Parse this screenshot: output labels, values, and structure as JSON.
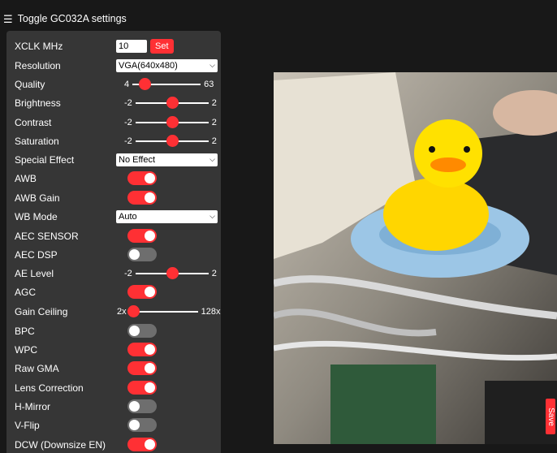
{
  "header": {
    "title": "Toggle GC032A settings"
  },
  "xclk": {
    "label": "XCLK MHz",
    "value": "10",
    "set_label": "Set"
  },
  "resolution": {
    "label": "Resolution",
    "selected": "VGA(640x480)"
  },
  "quality": {
    "label": "Quality",
    "min": "4",
    "max": "63",
    "value": 0.18
  },
  "brightness": {
    "label": "Brightness",
    "min": "-2",
    "max": "2",
    "value": 0.5
  },
  "contrast": {
    "label": "Contrast",
    "min": "-2",
    "max": "2",
    "value": 0.5
  },
  "saturation": {
    "label": "Saturation",
    "min": "-2",
    "max": "2",
    "value": 0.5
  },
  "special_effect": {
    "label": "Special Effect",
    "selected": "No Effect"
  },
  "awb": {
    "label": "AWB",
    "on": true
  },
  "awb_gain": {
    "label": "AWB Gain",
    "on": true
  },
  "wb_mode": {
    "label": "WB Mode",
    "selected": "Auto"
  },
  "aec_sensor": {
    "label": "AEC SENSOR",
    "on": true
  },
  "aec_dsp": {
    "label": "AEC DSP",
    "on": false
  },
  "ae_level": {
    "label": "AE Level",
    "min": "-2",
    "max": "2",
    "value": 0.5
  },
  "agc": {
    "label": "AGC",
    "on": true
  },
  "gain_ceiling": {
    "label": "Gain Ceiling",
    "min": "2x",
    "max": "128x",
    "value": 0.0
  },
  "bpc": {
    "label": "BPC",
    "on": false
  },
  "wpc": {
    "label": "WPC",
    "on": true
  },
  "raw_gma": {
    "label": "Raw GMA",
    "on": true
  },
  "lens_correction": {
    "label": "Lens Correction",
    "on": true
  },
  "hmirror": {
    "label": "H-Mirror",
    "on": false
  },
  "vflip": {
    "label": "V-Flip",
    "on": false
  },
  "dcw": {
    "label": "DCW (Downsize EN)",
    "on": true
  },
  "stream": {
    "save_label": "Save"
  },
  "colors": {
    "accent": "#ff3034",
    "panel": "#363636",
    "background": "#181818"
  }
}
